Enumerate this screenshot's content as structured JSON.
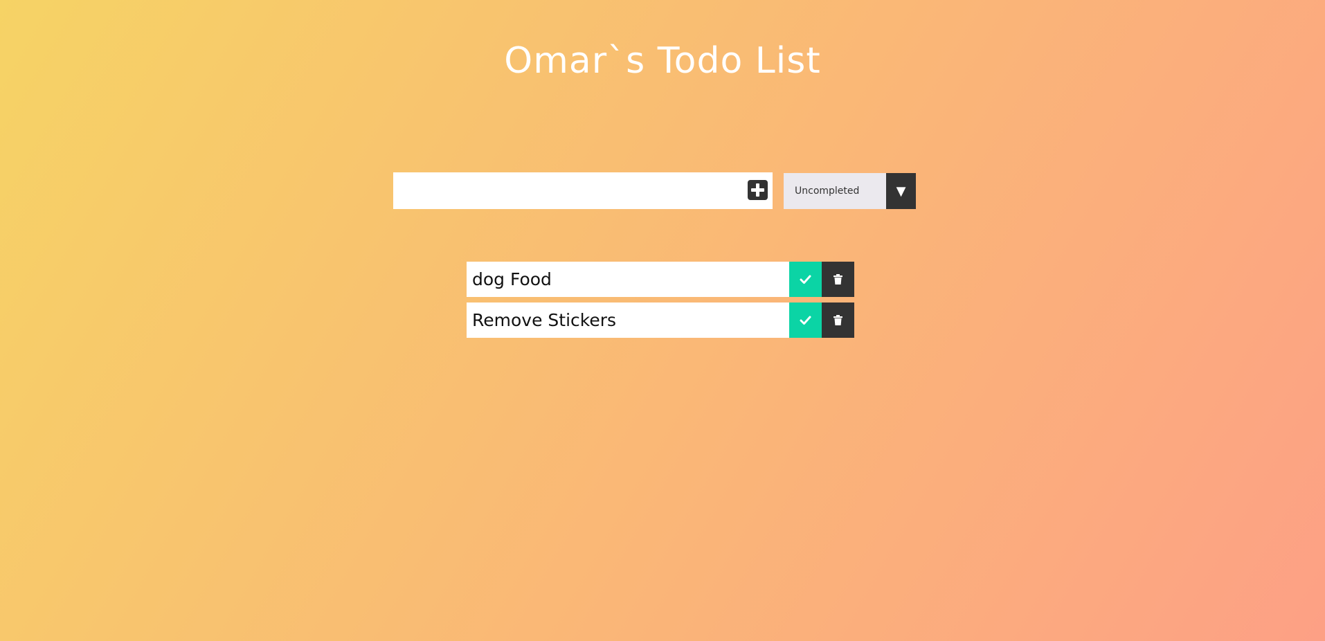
{
  "header": {
    "title": "Omar`s Todo List"
  },
  "form": {
    "input_value": "",
    "input_placeholder": "",
    "add_icon": "plus-square-icon"
  },
  "filter": {
    "selected": "Uncompleted",
    "arrow_glyph": "▼",
    "options": [
      "Uncompleted"
    ]
  },
  "todos": [
    {
      "text": "dog Food",
      "complete_icon": "check-icon",
      "delete_icon": "trash-icon"
    },
    {
      "text": "Remove Stickers",
      "complete_icon": "check-icon",
      "delete_icon": "trash-icon"
    }
  ],
  "colors": {
    "gradient_start": "#f6d365",
    "gradient_end": "#fda085",
    "complete_green": "#0bd4a5",
    "dark": "#333333"
  }
}
